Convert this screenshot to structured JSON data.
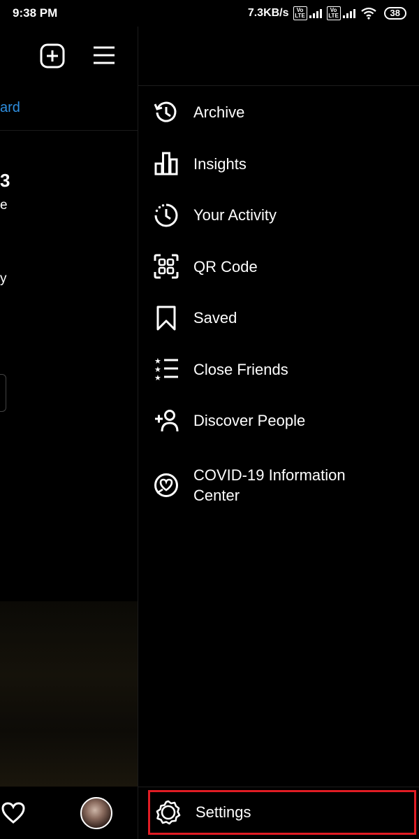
{
  "status_bar": {
    "time": "9:38 PM",
    "net_speed": "7.3KB/s",
    "volte_label": "Vo LTE",
    "battery": "38"
  },
  "left_panel": {
    "partial_link": "ard",
    "fragments": [
      "3",
      "e",
      "y"
    ]
  },
  "menu": {
    "items": [
      {
        "label": "Archive",
        "icon": "archive-icon"
      },
      {
        "label": "Insights",
        "icon": "insights-icon"
      },
      {
        "label": "Your Activity",
        "icon": "activity-icon"
      },
      {
        "label": "QR Code",
        "icon": "qr-code-icon"
      },
      {
        "label": "Saved",
        "icon": "bookmark-icon"
      },
      {
        "label": "Close Friends",
        "icon": "close-friends-icon"
      },
      {
        "label": "Discover People",
        "icon": "add-person-icon"
      },
      {
        "label": "COVID-19 Information Center",
        "icon": "covid-info-icon"
      }
    ],
    "settings_label": "Settings"
  },
  "colors": {
    "background": "#000000",
    "link": "#2f8fe0",
    "highlight": "#e01c24"
  }
}
